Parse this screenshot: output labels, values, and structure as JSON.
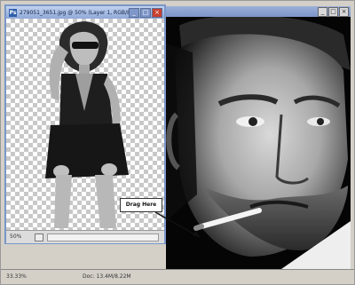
{
  "foreground_window": {
    "title": "279051_3651.jpg @ 50% (Layer 1, RGB/8#)",
    "zoom": "50%"
  },
  "background_window": {
    "zoom": "33.33%",
    "doc_info": "Doc: 13.4M/8.22M"
  },
  "callout": {
    "label": "Drag Here"
  }
}
